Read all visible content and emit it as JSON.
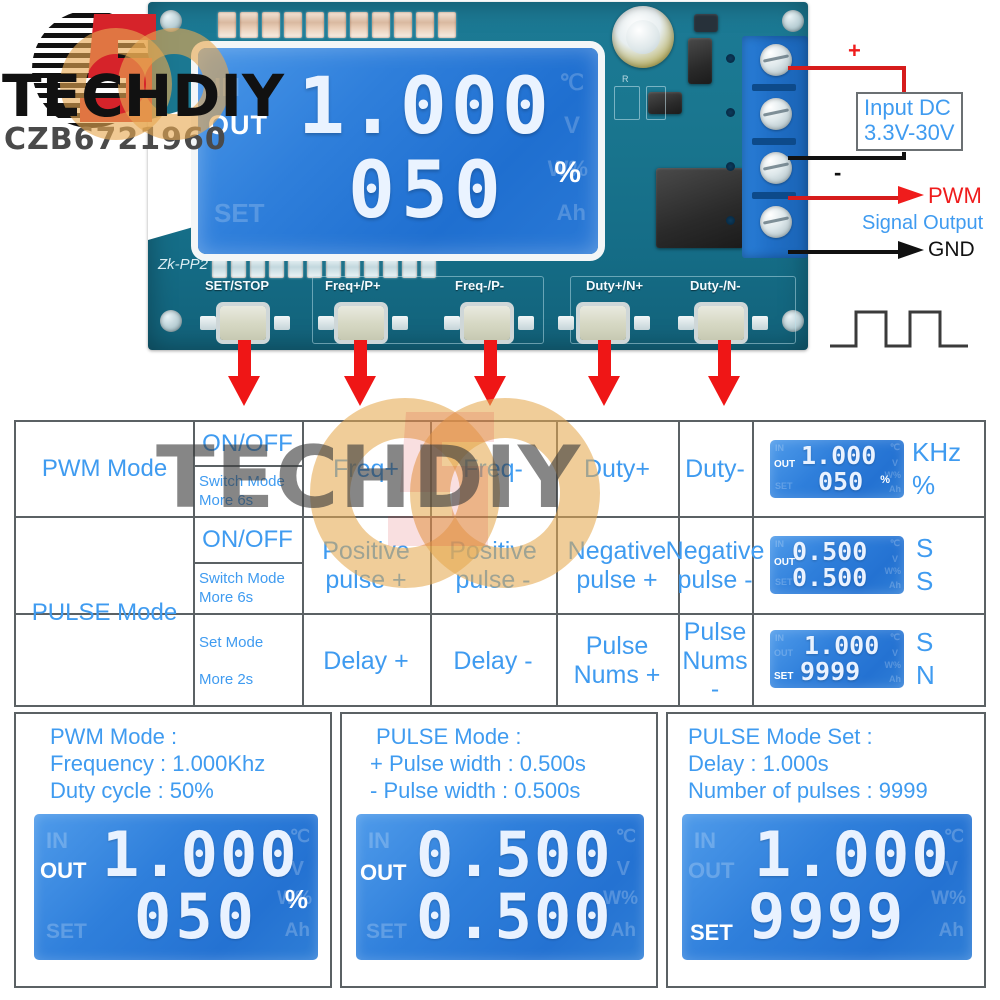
{
  "brand": {
    "watermark_text": "TECHDIY",
    "logo_text": "TECHDIY",
    "seller_code": "CZB6721960"
  },
  "board": {
    "silkscreen_model": "Zk-PP2",
    "silk_r": "R",
    "buttons": [
      {
        "name": "set-stop",
        "label": "SET/STOP"
      },
      {
        "name": "freq-up",
        "label": "Freq+/P+"
      },
      {
        "name": "freq-down",
        "label": "Freq-/P-"
      },
      {
        "name": "duty-up",
        "label": "Duty+/N+"
      },
      {
        "name": "duty-down",
        "label": "Duty-/N-"
      }
    ],
    "lcd": {
      "row1_label": "OUT",
      "row1_value": "1.000",
      "row2_value": "050",
      "row2_unit": "%",
      "ghost_left": [
        "IN",
        "OUT",
        "SET"
      ],
      "ghost_right": [
        "℃",
        "V",
        "W%",
        "Ah"
      ]
    }
  },
  "wiring": {
    "plus_sign": "+",
    "minus_sign": "-",
    "input_label_line1": "Input DC",
    "input_label_line2": "3.3V-30V",
    "pwm_label": "PWM",
    "signal_output_label": "Signal Output",
    "gnd_label": "GND",
    "waveform_icon": "square-wave"
  },
  "table": {
    "rows": [
      {
        "mode": "PWM Mode",
        "blocks": [
          {
            "col2_main": "ON/OFF",
            "col2_sub": "Switch Mode\nMore 6s",
            "cells": [
              "Freq+",
              "Freq-",
              "Duty+",
              "Duty-"
            ],
            "lcd": {
              "label_left": "OUT",
              "value_top": "1.000",
              "value_bottom": "050",
              "inline_unit": "%",
              "units": [
                "KHz",
                "%"
              ]
            }
          }
        ]
      },
      {
        "mode": "PULSE Mode",
        "blocks": [
          {
            "col2_main": "ON/OFF",
            "col2_sub": "Switch Mode\nMore 6s",
            "cells": [
              "Positive\npulse +",
              "Positive\npulse -",
              "Negative\npulse +",
              "Negative\npulse -"
            ],
            "lcd": {
              "label_left": "OUT",
              "value_top": "0.500",
              "value_bottom": "0.500",
              "inline_unit": "",
              "units": [
                "S",
                "S"
              ]
            }
          },
          {
            "col2_main": "Set Mode",
            "col2_sub": "More 2s",
            "cells": [
              "Delay +",
              "Delay -",
              "Pulse\nNums +",
              "Pulse\nNums -"
            ],
            "lcd": {
              "label_left": "SET",
              "value_top": "1.000",
              "value_bottom": "9999",
              "inline_unit": "",
              "units": [
                "S",
                "N"
              ]
            }
          }
        ]
      }
    ]
  },
  "panels": [
    {
      "name": "pwm-mode-panel",
      "lines": [
        "PWM Mode :",
        "Frequency : 1.000Khz",
        "Duty cycle : 50%"
      ],
      "lcd": {
        "label_left": "OUT",
        "value_top": "1.000",
        "value_bottom": "050",
        "unit": "%"
      }
    },
    {
      "name": "pulse-mode-panel",
      "lines": [
        "PULSE Mode :",
        "+ Pulse width : 0.500s",
        "- Pulse width : 0.500s"
      ],
      "lcd": {
        "label_left": "OUT",
        "value_top": "0.500",
        "value_bottom": "0.500",
        "unit": ""
      }
    },
    {
      "name": "pulse-mode-set-panel",
      "lines": [
        "PULSE Mode Set :",
        "Delay : 1.000s",
        "Number of pulses : 9999"
      ],
      "lcd": {
        "label_left": "SET",
        "value_top": "1.000",
        "value_bottom": "9999",
        "unit": ""
      }
    }
  ],
  "colors": {
    "accent_blue": "#3f9bf0",
    "arrow_red": "#ef1616",
    "wire_red": "#d61c1c",
    "wire_black": "#111111",
    "border_gray": "#5b6164",
    "lcd_blue": "#2f7fdb",
    "pcb_teal": "#1a7790",
    "watermark_orange": "#e6a850"
  },
  "ghost": {
    "left": [
      "IN",
      "OUT",
      "SET"
    ],
    "right": [
      "℃",
      "V",
      "W%",
      "Ah"
    ]
  }
}
